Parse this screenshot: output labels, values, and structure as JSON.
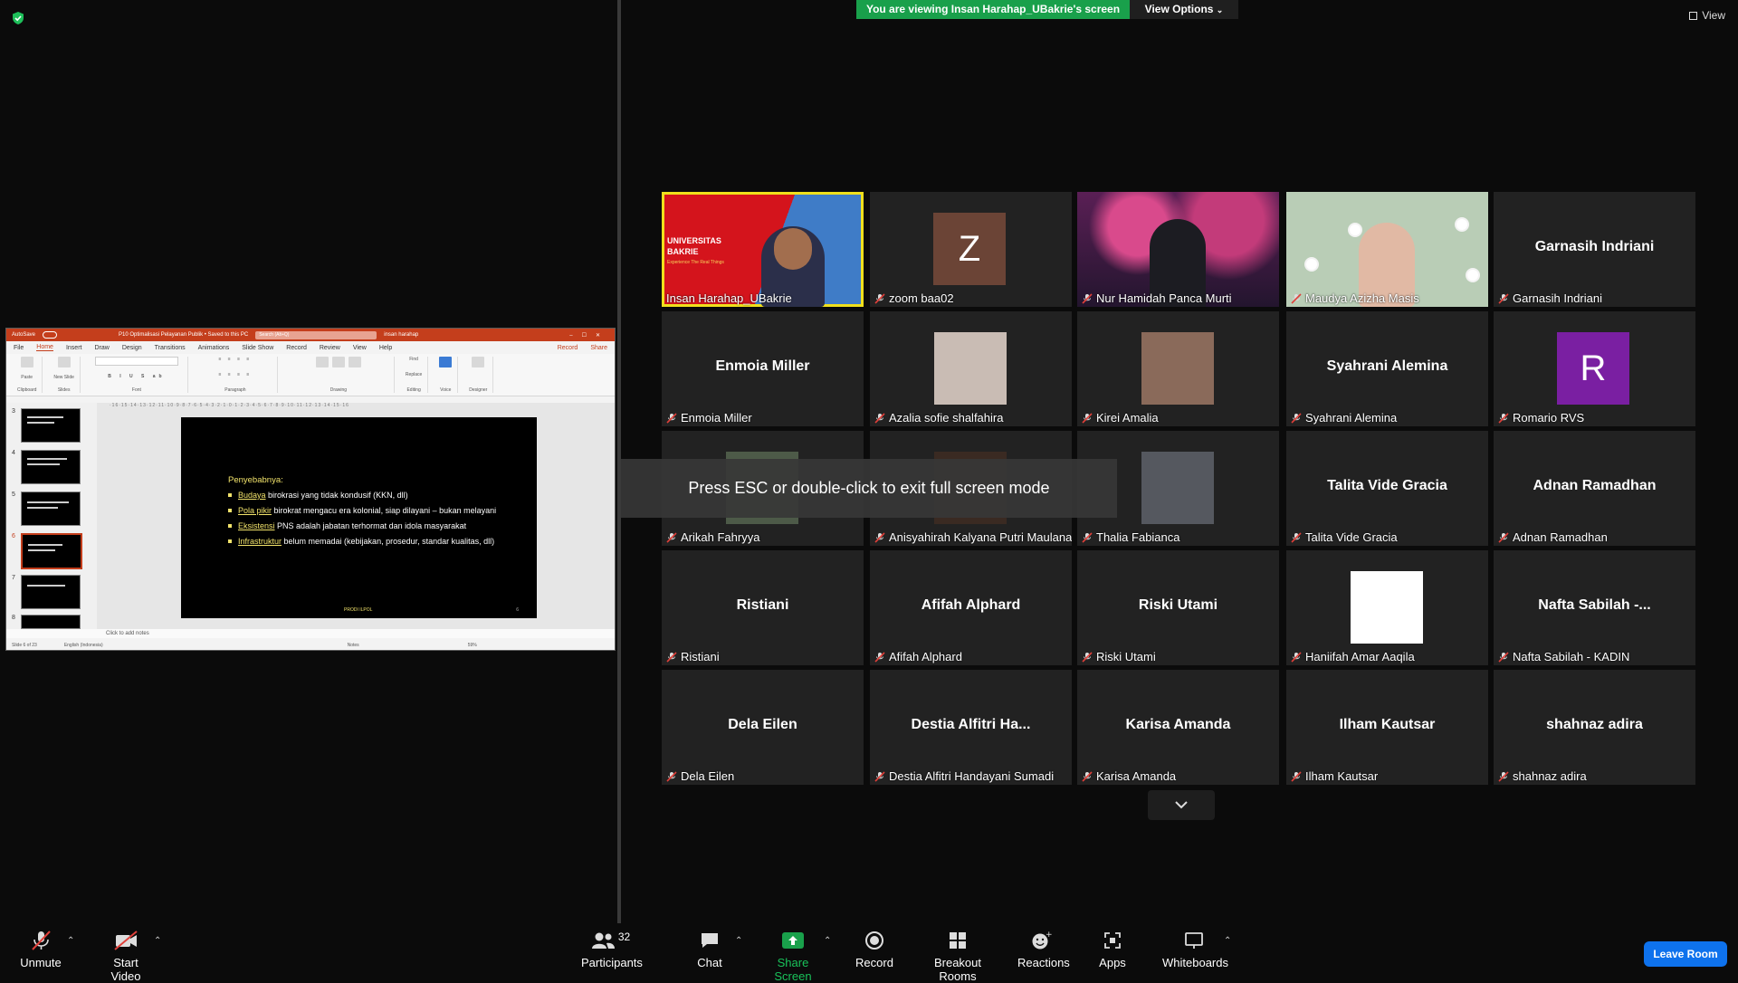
{
  "share": {
    "banner": "You are viewing Insan Harahap_UBakrie's screen",
    "view_options": "View Options",
    "view_label": "View"
  },
  "ppt": {
    "autosave": "AutoSave",
    "title": "P10 Optimalisasi Pelayanan Publik • Saved to this PC",
    "search_placeholder": "Search (Alt+Q)",
    "user": "insan harahap",
    "tabs": [
      "File",
      "Home",
      "Insert",
      "Draw",
      "Design",
      "Transitions",
      "Animations",
      "Slide Show",
      "Record",
      "Review",
      "View",
      "Help"
    ],
    "record_btn": "Record",
    "share_btn": "Share",
    "ribbon_groups": [
      "Clipboard",
      "Slides",
      "Font",
      "Paragraph",
      "Drawing",
      "Editing",
      "Voice",
      "Designer"
    ],
    "ribbon_buttons": [
      "Paste",
      "New Slide",
      "Layout",
      "Reset",
      "Section",
      "Shapes",
      "Arrange",
      "Quick Styles",
      "Shape Fill",
      "Shape Outline",
      "Shape Effects",
      "Find",
      "Replace",
      "Select",
      "Dictate",
      "Designer"
    ],
    "thumb_numbers": [
      "3",
      "4",
      "5",
      "6",
      "7",
      "8"
    ],
    "slide": {
      "title": "Penyebabnya:",
      "items": [
        {
          "hl": "Budaya",
          "rest": " birokrasi yang tidak kondusif (KKN, dll)"
        },
        {
          "hl": "Pola pikir",
          "rest": " birokrat mengacu era kolonial, siap dilayani – bukan melayani"
        },
        {
          "hl": "Eksistensi",
          "rest": " PNS adalah jabatan terhormat dan idola masyarakat"
        },
        {
          "hl": "Infrastruktur",
          "rest": " belum memadai (kebijakan, prosedur, standar kualitas, dll)"
        }
      ],
      "footer": "PRODI ILPOL",
      "number": "6"
    },
    "notes": "Click to add notes",
    "status_slide": "Slide 6 of 23",
    "status_lang": "English (Indonesia)",
    "status_notes": "Notes",
    "status_zoom": "59%"
  },
  "tiles": [
    {
      "big": "",
      "label": "Insan Harahap_UBakrie",
      "kind": "ubakrie",
      "muted": false,
      "active": true
    },
    {
      "big": "",
      "label": "zoom baa02",
      "kind": "letter",
      "letter": "Z",
      "color": "#6b4436",
      "muted": true
    },
    {
      "big": "",
      "label": "Nur Hamidah Panca Murti",
      "kind": "blossom",
      "muted": true
    },
    {
      "big": "",
      "label": "Maudya Azizha Masis",
      "kind": "daisy",
      "muted": true
    },
    {
      "big": "Garnasih Indriani",
      "label": "Garnasih Indriani",
      "kind": "name",
      "muted": true
    },
    {
      "big": "Enmoia Miller",
      "label": "Enmoia Miller",
      "kind": "name",
      "muted": true
    },
    {
      "big": "",
      "label": "Azalia sofie shalfahira",
      "kind": "photo",
      "photo": "#c9bcb4",
      "muted": true
    },
    {
      "big": "",
      "label": "Kirei Amalia",
      "kind": "photo",
      "photo": "#8a6a5a",
      "muted": true
    },
    {
      "big": "Syahrani Alemina",
      "label": "Syahrani Alemina",
      "kind": "name",
      "muted": true
    },
    {
      "big": "",
      "label": "Romario RVS",
      "kind": "letter",
      "letter": "R",
      "color": "#7a1fa2",
      "muted": true
    },
    {
      "big": "",
      "label": "Arikah Fahryya",
      "kind": "photo",
      "photo": "#4d5a48",
      "muted": true
    },
    {
      "big": "",
      "label": "Anisyahirah Kalyana Putri Maulana",
      "kind": "photo",
      "photo": "#3a2a22",
      "muted": true
    },
    {
      "big": "",
      "label": "Thalia Fabianca",
      "kind": "photo",
      "photo": "#55585f",
      "muted": true
    },
    {
      "big": "Talita Vide Gracia",
      "label": "Talita Vide Gracia",
      "kind": "name",
      "muted": true
    },
    {
      "big": "Adnan Ramadhan",
      "label": "Adnan Ramadhan",
      "kind": "name",
      "muted": true
    },
    {
      "big": "Ristiani",
      "label": "Ristiani",
      "kind": "name",
      "muted": true
    },
    {
      "big": "Afifah Alphard",
      "label": "Afifah Alphard",
      "kind": "name",
      "muted": true
    },
    {
      "big": "Riski Utami",
      "label": "Riski Utami",
      "kind": "name",
      "muted": true
    },
    {
      "big": "",
      "label": "Haniifah Amar Aaqila",
      "kind": "photo",
      "photo": "#ffffff",
      "muted": true
    },
    {
      "big": "Nafta Sabilah -...",
      "label": "Nafta Sabilah - KADIN",
      "kind": "name",
      "muted": true
    },
    {
      "big": "Dela Eilen",
      "label": "Dela Eilen",
      "kind": "name",
      "muted": true
    },
    {
      "big": "Destia Alfitri Ha...",
      "label": "Destia Alfitri Handayani Sumadi",
      "kind": "name",
      "muted": true
    },
    {
      "big": "Karisa Amanda",
      "label": "Karisa Amanda",
      "kind": "name",
      "muted": true
    },
    {
      "big": "Ilham Kautsar",
      "label": "Ilham Kautsar",
      "kind": "name",
      "muted": true
    },
    {
      "big": "shahnaz adira",
      "label": "shahnaz adira",
      "kind": "name",
      "muted": true
    }
  ],
  "ubakrie": {
    "line1": "UNIVERSITAS",
    "line2": "BAKRIE",
    "tagline": "Experience The Real Things"
  },
  "esc_toast": "Press ESC or double-click to exit full screen mode",
  "toolbar": {
    "unmute": "Unmute",
    "start_video": "Start Video",
    "participants": "Participants",
    "participants_count": "32",
    "chat": "Chat",
    "share_screen": "Share Screen",
    "record": "Record",
    "breakout": "Breakout Rooms",
    "reactions": "Reactions",
    "apps": "Apps",
    "whiteboards": "Whiteboards",
    "leave": "Leave Room"
  },
  "colors": {
    "banner": "#19a04b",
    "leave": "#0e72ed",
    "share_icon": "#19a04b",
    "active_border": "#f0e01c",
    "ppt_accent": "#c43e1c"
  }
}
